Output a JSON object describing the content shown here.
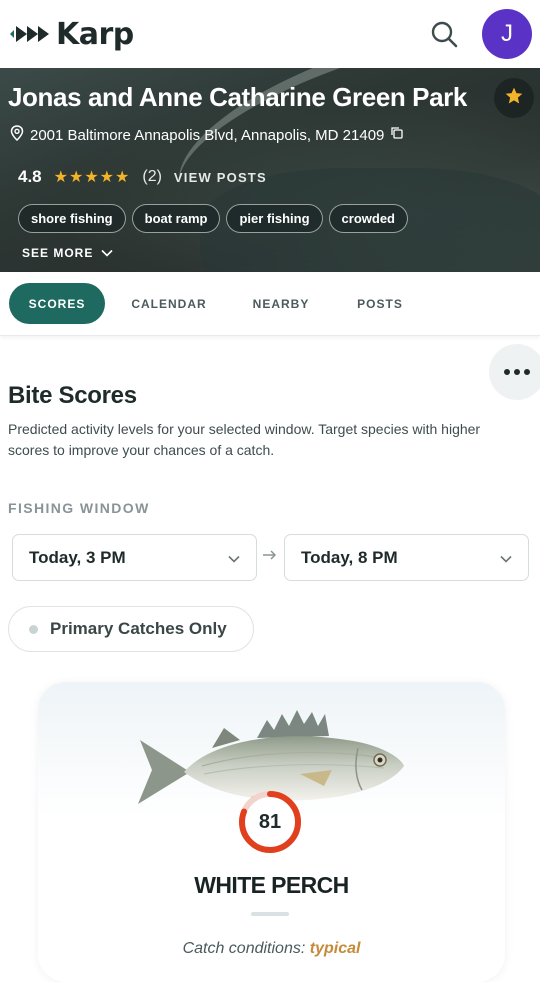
{
  "app": {
    "name": "Karp"
  },
  "user": {
    "avatar_initial": "J"
  },
  "park": {
    "title": "Jonas and Anne Catharine Green Park",
    "address": "2001 Baltimore Annapolis Blvd, Annapolis, MD 21409",
    "rating": "4.8",
    "rating_stars": 5,
    "review_count": "(2)",
    "view_posts_label": "VIEW POSTS",
    "tags": [
      "shore fishing",
      "boat ramp",
      "pier fishing",
      "crowded"
    ],
    "see_more_label": "SEE MORE"
  },
  "tabs": [
    {
      "label": "SCORES",
      "active": true
    },
    {
      "label": "CALENDAR",
      "active": false
    },
    {
      "label": "NEARBY",
      "active": false
    },
    {
      "label": "POSTS",
      "active": false
    }
  ],
  "bite_scores": {
    "title": "Bite Scores",
    "description": "Predicted activity levels for your selected window. Target species with higher scores to improve your chances of a catch.",
    "window_label": "FISHING WINDOW",
    "window_start": "Today, 3 PM",
    "window_end": "Today, 8 PM",
    "filter_label": "Primary Catches Only"
  },
  "species_card": {
    "name": "WHITE PERCH",
    "score": "81",
    "score_fraction": 0.81,
    "conditions_label": "Catch conditions:",
    "conditions_value": "typical"
  },
  "colors": {
    "accent": "#1f6a60",
    "avatar": "#5a33c6",
    "star": "#f2b429",
    "score_ring": "#e0401e",
    "conditions_value": "#c58a3a"
  },
  "icons": {
    "search": "search-icon",
    "star": "star-icon",
    "location": "location-pin-icon",
    "copy": "copy-icon",
    "chevron": "chevron-down-icon",
    "more": "more-horizontal-icon",
    "arrow": "arrow-right-icon"
  }
}
